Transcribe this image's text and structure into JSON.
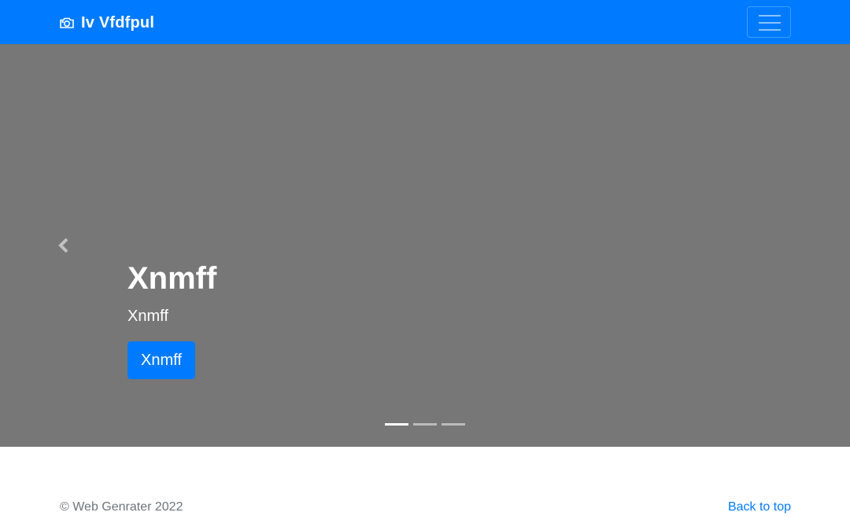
{
  "navbar": {
    "brand_text": "Iv Vfdfpul",
    "brand_icon": "camera-icon",
    "toggler_icon": "hamburger-menu-icon",
    "bg_color": "#007bff"
  },
  "carousel": {
    "bg_color": "#777777",
    "slide_count": 3,
    "active_index": 0,
    "caption": {
      "title": "Xnmff",
      "subtitle": "Xnmff",
      "button_label": "Xnmff"
    },
    "prev_icon": "chevron-left-icon",
    "next_icon": "chevron-right-icon"
  },
  "footer": {
    "copyright": "© Web Genrater 2022",
    "back_to_top": "Back to top"
  }
}
